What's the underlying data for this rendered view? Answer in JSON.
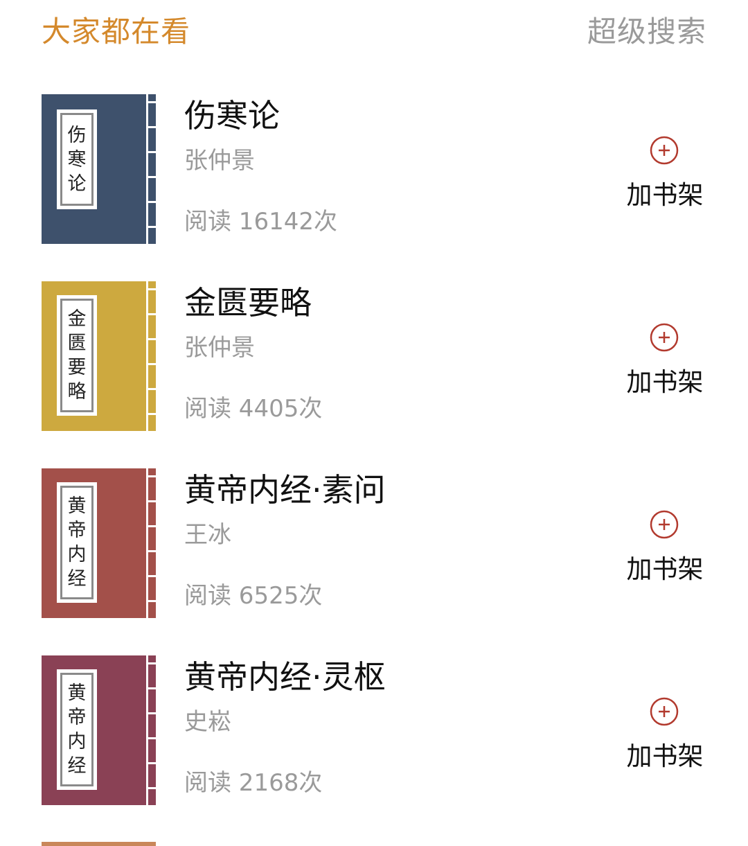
{
  "header": {
    "title": "大家都在看",
    "search_link": "超级搜索"
  },
  "colors": {
    "accent": "#d4892c",
    "muted": "#9a9a9a",
    "plus_red": "#b23a2e"
  },
  "books": [
    {
      "title": "伤寒论",
      "author": "张仲景",
      "reads": "阅读 16142次",
      "cover_label": [
        "伤",
        "寒",
        "论"
      ],
      "cover_color": "#3e516c",
      "add_label": "加书架",
      "icon": "plus-circle-icon"
    },
    {
      "title": "金匮要略",
      "author": "张仲景",
      "reads": "阅读 4405次",
      "cover_label": [
        "金",
        "匮",
        "要",
        "略"
      ],
      "cover_color": "#cda93f",
      "add_label": "加书架",
      "icon": "plus-circle-icon"
    },
    {
      "title": "黄帝内经·素问",
      "author": "王冰",
      "reads": "阅读 6525次",
      "cover_label": [
        "黄",
        "帝",
        "内",
        "经"
      ],
      "cover_color": "#a3504a",
      "add_label": "加书架",
      "icon": "plus-circle-icon"
    },
    {
      "title": "黄帝内经·灵枢",
      "author": "史崧",
      "reads": "阅读 2168次",
      "cover_label": [
        "黄",
        "帝",
        "内",
        "经"
      ],
      "cover_color": "#8a4155",
      "add_label": "加书架",
      "icon": "plus-circle-icon"
    }
  ],
  "partial_book": {
    "cover_color": "#c9875a"
  }
}
